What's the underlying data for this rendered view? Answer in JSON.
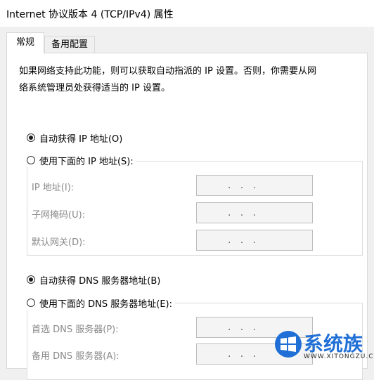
{
  "window": {
    "title": "Internet 协议版本 4 (TCP/IPv4) 属性"
  },
  "tabs": [
    {
      "label": "常规",
      "active": true
    },
    {
      "label": "备用配置",
      "active": false
    }
  ],
  "general": {
    "description_line1": "如果网络支持此功能，则可以获取自动指派的 IP 设置。否则，你需要从网",
    "description_line2": "络系统管理员处获得适当的 IP 设置。",
    "ip_auto_label": "自动获得 IP 地址(O)",
    "ip_manual_label": "使用下面的 IP 地址(S):",
    "ip_fields": [
      {
        "label": "IP 地址(I):",
        "value": ".   .   ."
      },
      {
        "label": "子网掩码(U):",
        "value": ".   .   ."
      },
      {
        "label": "默认网关(D):",
        "value": ".   .   ."
      }
    ],
    "dns_auto_label": "自动获得 DNS 服务器地址(B)",
    "dns_manual_label": "使用下面的 DNS 服务器地址(E):",
    "dns_fields": [
      {
        "label": "首选 DNS 服务器(P):",
        "value": ".   .   ."
      },
      {
        "label": "备用 DNS 服务器(A):",
        "value": ".   .   ."
      }
    ]
  },
  "watermark": {
    "text": "系统族",
    "url": "WWW.XITONGZU.COM",
    "accent": "#1f6fd6"
  }
}
